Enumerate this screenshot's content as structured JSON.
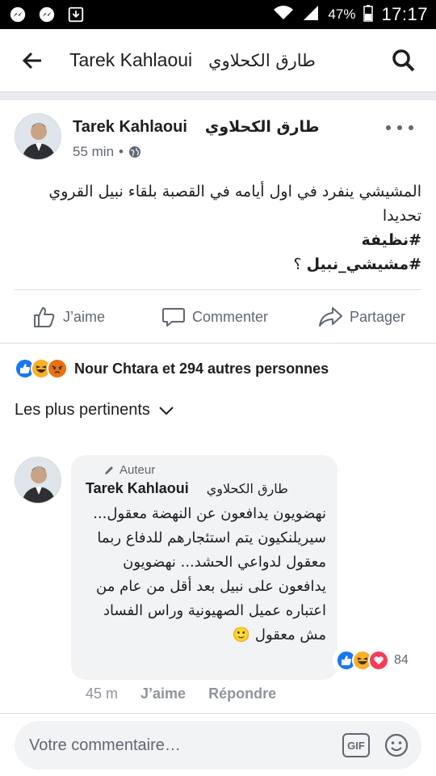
{
  "status_bar": {
    "battery": "47%",
    "time": "17:17"
  },
  "header": {
    "name_latin": "Tarek Kahlaoui",
    "name_arabic": "طارق الكحلاوي"
  },
  "post": {
    "author_latin": "Tarek Kahlaoui",
    "author_arabic": "طارق الكحلاوي",
    "time": "55 min",
    "dot": "•",
    "text_line1": "المشيشي ينفرد في اول أيامه في القصبة بلقاء نبيل القروي تحديدا",
    "hashtag1": "#نظيفة",
    "hashtag2": "#مشيشي_نبيل",
    "hashtag2_suffix": " ؟",
    "actions": {
      "like": "J’aime",
      "comment": "Commenter",
      "share": "Partager"
    }
  },
  "reactions_summary": {
    "text": "Nour Chtara et 294 autres personnes",
    "colors": {
      "like": "#1877f2",
      "haha": "#f7b125",
      "angry": "#e9710f",
      "love": "#f33e58"
    }
  },
  "comments_sort": {
    "label": "Les plus pertinents"
  },
  "comment": {
    "badge": "Auteur",
    "author_latin": "Tarek Kahlaoui",
    "author_arabic": "طارق الكحلاوي",
    "text": "نهضويون يدافعون عن النهضة معقول... سيريلنكيون يتم استئجارهم للدفاع ربما معقول لدواعي الحشد... نهضويون يدافعون على نبيل بعد أقل من عام من اعتباره عميل الصهيونية وراس الفساد مش معقول",
    "emoji": "🙂",
    "reaction_count": "84",
    "time": "45 m",
    "like": "J’aime",
    "reply": "Répondre"
  },
  "composer": {
    "placeholder": "Votre commentaire…",
    "gif": "GIF"
  }
}
